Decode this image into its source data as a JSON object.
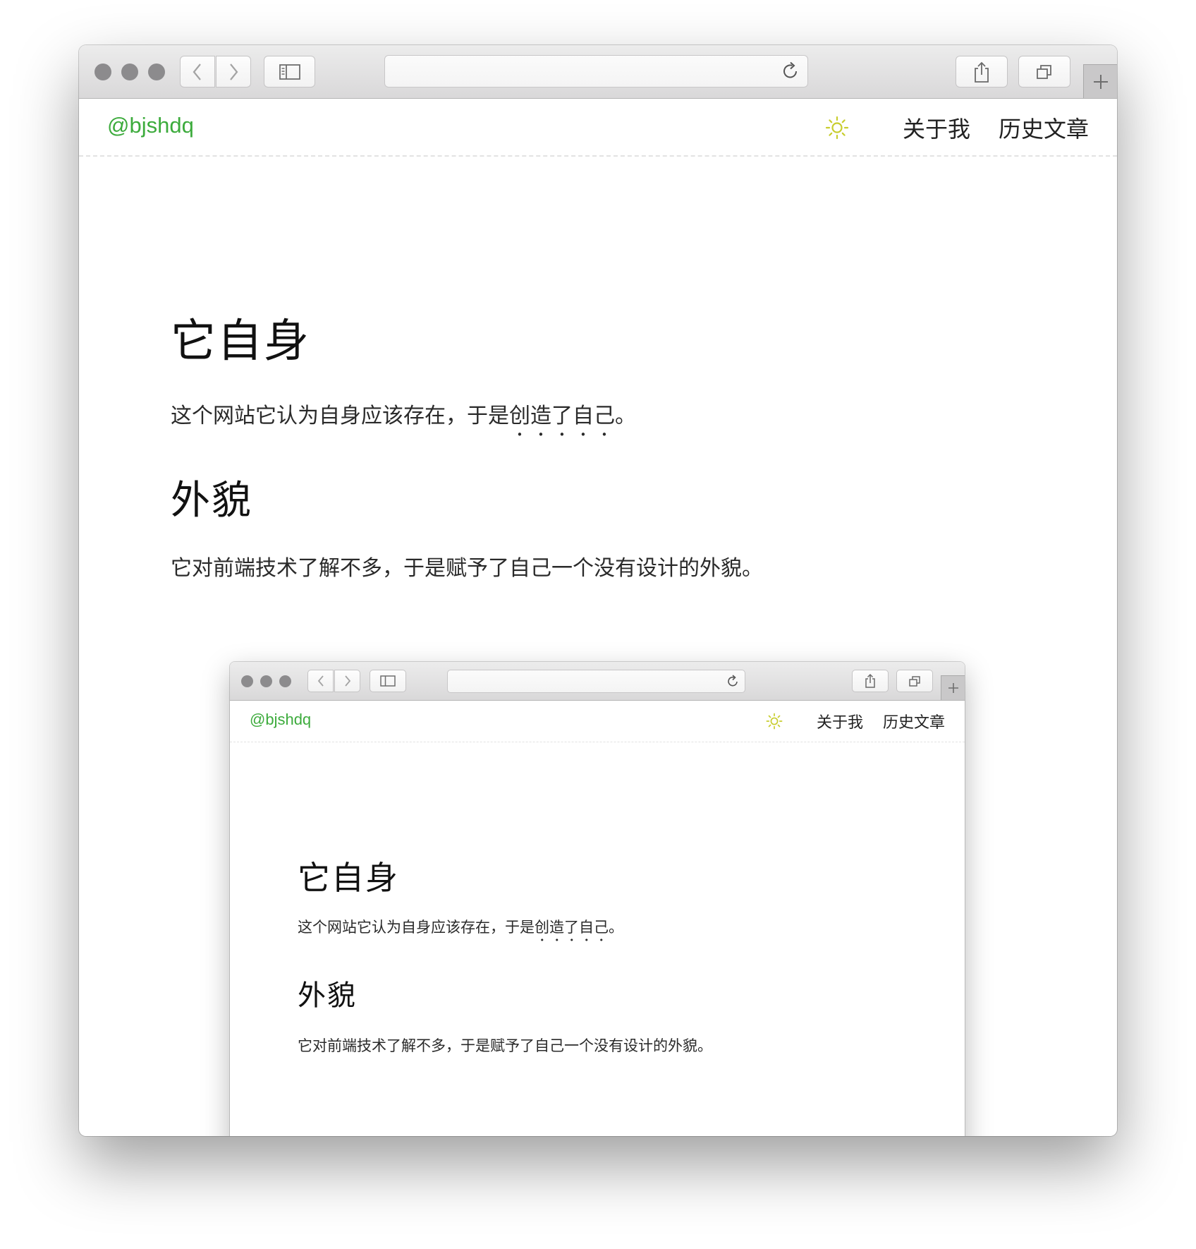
{
  "site": {
    "brand": "@bjshdq",
    "nav": [
      "关于我",
      "历史文章"
    ]
  },
  "article": {
    "heading1": "它自身",
    "para1_before": "这个网站它认为自身应该存在，于是",
    "para1_emphasis": "创造了自己",
    "para1_after": "。",
    "heading2": "外貌",
    "para2": "它对前端技术了解不多，于是赋予了自己一个没有设计的外貌。"
  },
  "icons": {
    "traffic_lights": "traffic-light-icons",
    "back": "chevron-left-icon",
    "forward": "chevron-right-icon",
    "sidebar": "sidebar-icon",
    "reload": "reload-icon",
    "share": "share-icon",
    "tabs": "tabs-overview-icon",
    "new_tab": "plus-icon",
    "theme": "sun-icon"
  },
  "colors": {
    "brand": "#3cab3c",
    "sun": "#c8cd2e",
    "text": "#222222"
  }
}
